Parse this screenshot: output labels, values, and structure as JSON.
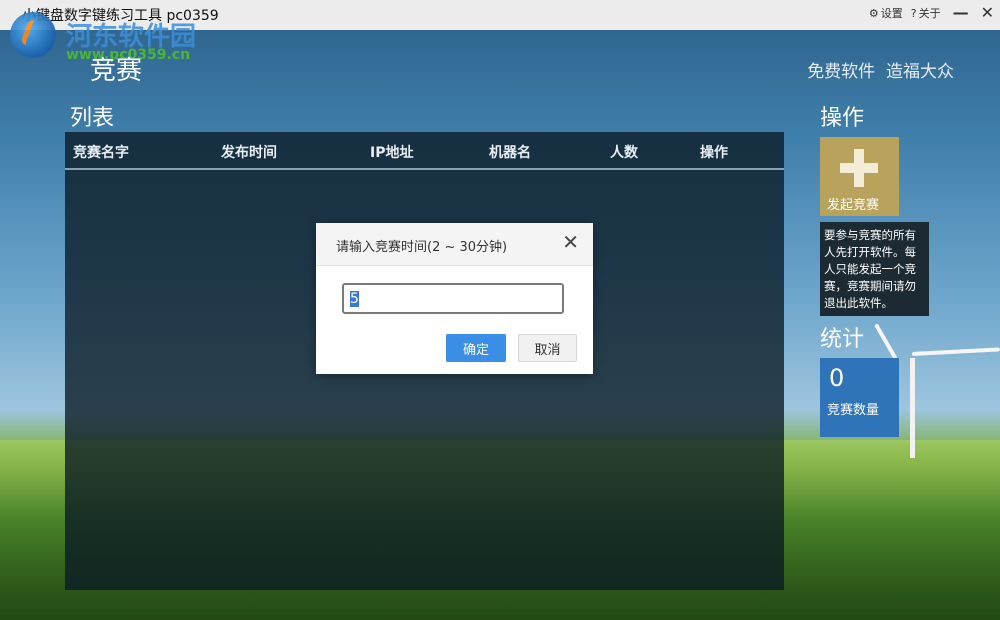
{
  "window": {
    "title": "小键盘数字键练习工具 pc0359",
    "settings_label": "设置",
    "about_label": "关于",
    "minimize_glyph": "—",
    "close_glyph": "✕"
  },
  "watermark": {
    "name": "河东软件园",
    "url": "www.pc0359.cn"
  },
  "header": {
    "page_title": "竞赛",
    "slogan": "免费软件  造福大众"
  },
  "list": {
    "title": "列表",
    "columns": [
      "竞赛名字",
      "发布时间",
      "IP地址",
      "机器名",
      "人数",
      "操作"
    ],
    "rows": []
  },
  "operations": {
    "title": "操作",
    "start_button": "发起竞赛",
    "info": "要参与竞赛的所有人先打开软件。每人只能发起一个竞赛，竞赛期间请勿退出此软件。"
  },
  "stats": {
    "title": "统计",
    "count_value": "0",
    "count_label": "竞赛数量"
  },
  "dialog": {
    "title": "请输入竞赛时间(2 ~ 30分钟)",
    "close_glyph": "✕",
    "input_value": "5",
    "ok_label": "确定",
    "cancel_label": "取消"
  },
  "colors": {
    "accent_blue": "#3a8ee6",
    "op_card": "#b9a35c",
    "stat_card": "#2f74b8"
  }
}
